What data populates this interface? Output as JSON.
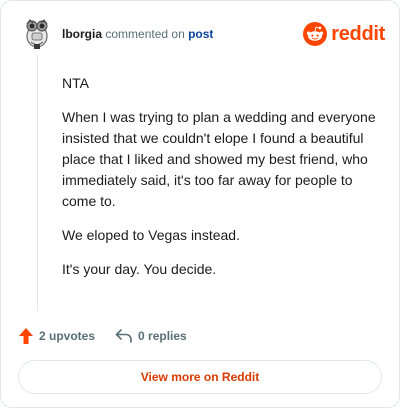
{
  "comment": {
    "username": "lborgia",
    "action_text": "commented on",
    "post_link": "post",
    "paragraphs": [
      "NTA",
      "When I was trying to plan a wedding and everyone insisted that we couldn't elope I found a beautiful place that I liked and showed my best friend, who immediately said, it's too far away for people to come to.",
      "We eloped to Vegas instead.",
      "It's your day. You decide."
    ]
  },
  "brand": {
    "name": "reddit",
    "logo_icon": "reddit-snoo-icon",
    "color": "#ff4500"
  },
  "actions": {
    "upvotes": "2 upvotes",
    "replies": "0 replies"
  },
  "footer": {
    "view_more_label": "View more on Reddit"
  },
  "colors": {
    "accent": "#ff4500",
    "link": "#0a449b",
    "muted": "#576f76",
    "button_text": "#d93a00",
    "border": "#e3e6e8"
  }
}
